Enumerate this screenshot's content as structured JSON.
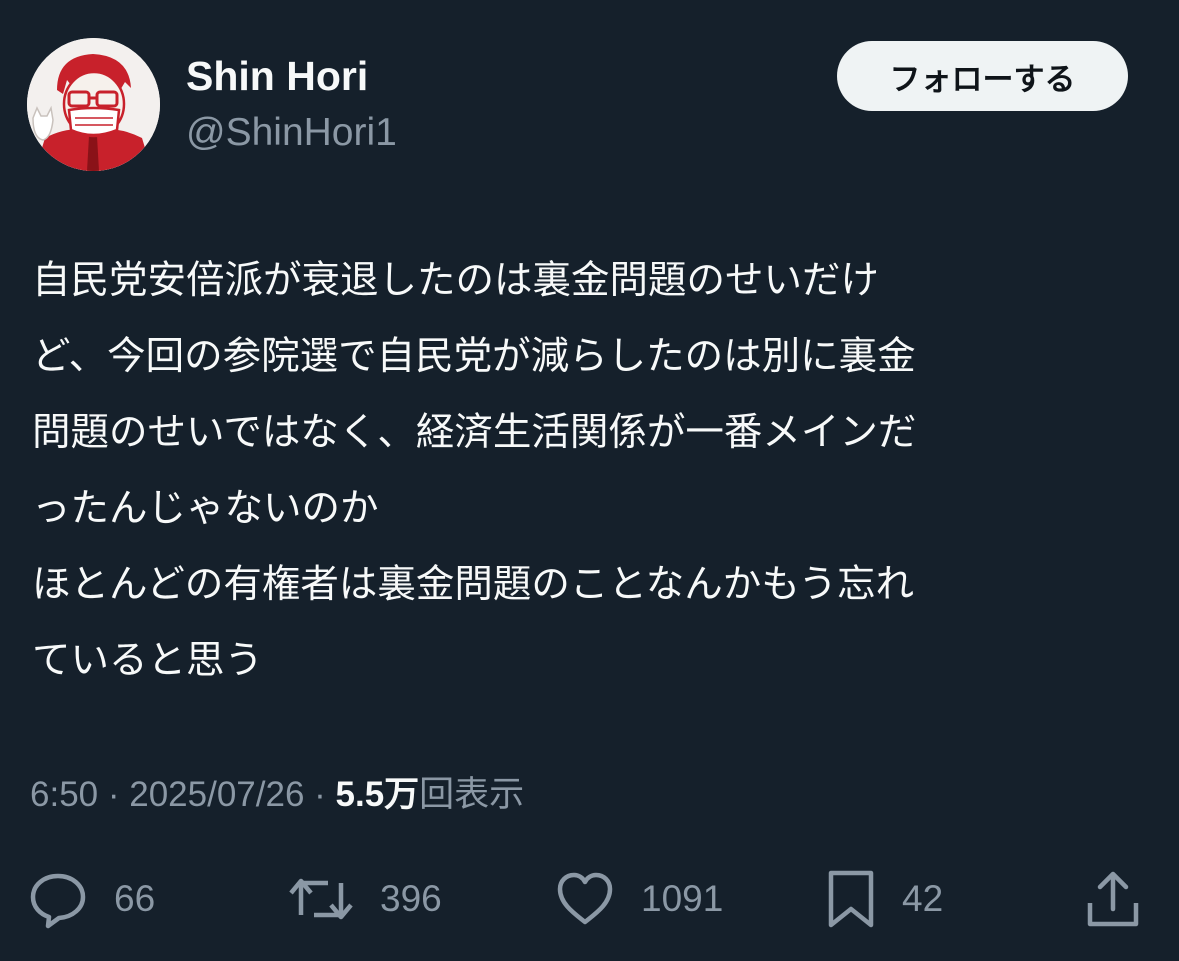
{
  "user": {
    "display_name": "Shin Hori",
    "handle": "@ShinHori1",
    "avatar_icon": "avatar-illustration"
  },
  "follow_button": {
    "label": "フォローする"
  },
  "tweet": {
    "lines": [
      "自民党安倍派が衰退したのは裏金問題のせいだけ",
      "ど、今回の参院選で自民党が減らしたのは別に裏金",
      "問題のせいではなく、経済生活関係が一番メインだ",
      "ったんじゃないのか",
      "ほとんどの有権者は裏金問題のことなんかもう忘れ",
      "ていると思う"
    ]
  },
  "meta": {
    "time": "6:50",
    "separator": " · ",
    "date": "2025/07/26",
    "views_count": "5.5万",
    "views_label": "回表示"
  },
  "actions": {
    "reply": {
      "icon": "reply-icon",
      "count": "66"
    },
    "retweet": {
      "icon": "retweet-icon",
      "count": "396"
    },
    "like": {
      "icon": "heart-icon",
      "count": "1091"
    },
    "bookmark": {
      "icon": "bookmark-icon",
      "count": "42"
    },
    "share": {
      "icon": "share-icon"
    }
  },
  "colors": {
    "background": "#15202b",
    "primary_text": "#f7f9f9",
    "secondary_text": "#8b98a5",
    "button_bg": "#eff3f4",
    "button_text": "#0f1419",
    "avatar_accent": "#c8212b"
  }
}
